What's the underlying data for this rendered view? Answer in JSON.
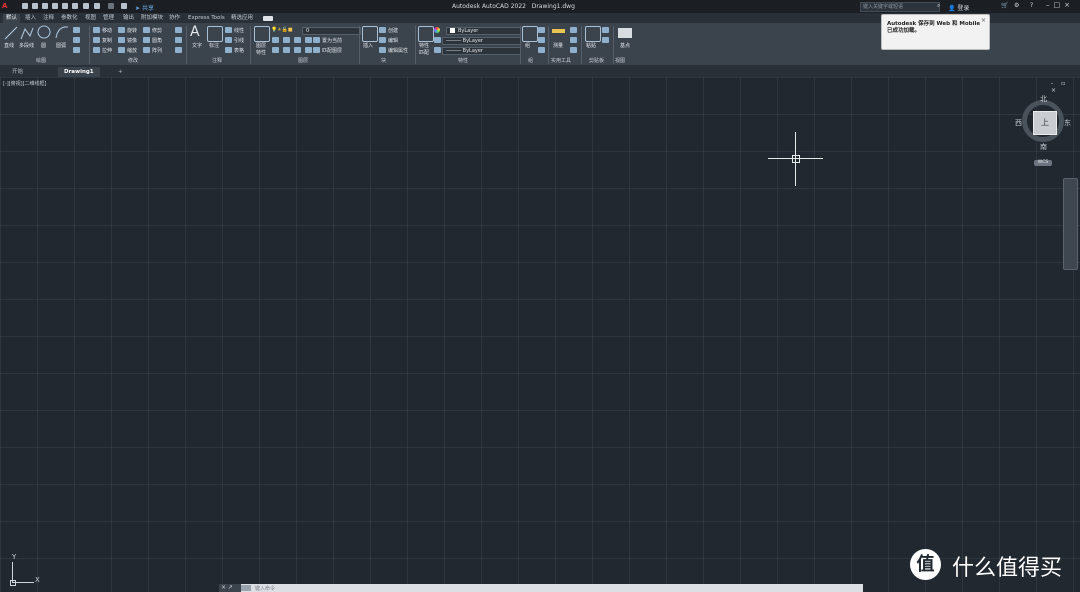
{
  "app": {
    "logo": "A",
    "title": "Autodesk AutoCAD 2022",
    "document": "Drawing1.dwg",
    "share_label": "共享",
    "search_placeholder": "键入关键字或短语",
    "login_label": "登录"
  },
  "ribbon_tabs": [
    "默认",
    "插入",
    "注释",
    "参数化",
    "视图",
    "管理",
    "输出",
    "附加模块",
    "协作",
    "Express Tools",
    "精选应用"
  ],
  "ribbon": {
    "draw": {
      "line": "直线",
      "polyline": "多段线",
      "circle": "圆",
      "arc": "圆弧",
      "panel": "绘图"
    },
    "modify": {
      "move": "移动",
      "rotate": "旋转",
      "trim": "修剪",
      "copy": "复制",
      "mirror": "镜像",
      "fillet": "圆角",
      "stretch": "拉伸",
      "scale": "缩放",
      "array": "阵列",
      "panel": "修改"
    },
    "annotation": {
      "text": "文字",
      "dimension": "标注",
      "linear": "线性",
      "leader": "引线",
      "table": "表格",
      "panel": "注释"
    },
    "layers": {
      "layer_props": "图层",
      "layer_props2": "特性",
      "current_layer": "0",
      "set_current": "置为当前",
      "match_layer": "匹配图层",
      "panel": "图层"
    },
    "block": {
      "insert": "插入",
      "create": "创建",
      "edit": "编辑",
      "edit_attr": "编辑属性",
      "panel": "块"
    },
    "properties": {
      "match": "特性",
      "match2": "匹配",
      "color": "ByLayer",
      "linetype": "ByLayer",
      "lineweight": "ByLayer",
      "panel": "特性"
    },
    "groups": {
      "group": "组",
      "panel": "组"
    },
    "utilities": {
      "measure": "测量",
      "panel": "实用工具"
    },
    "clipboard": {
      "paste": "粘贴",
      "panel": "剪贴板"
    },
    "view": {
      "base": "基点",
      "panel": "视图"
    }
  },
  "notification": {
    "message": "Autodesk 保存到 Web 和 Mobile 已成功加载。",
    "close": "×"
  },
  "file_tabs": [
    "开始",
    "Drawing1",
    "+"
  ],
  "viewport": {
    "label": "[-][俯视][二维线框]",
    "controls": "- ▫ ×"
  },
  "viewcube": {
    "north": "北",
    "south": "南",
    "east": "东",
    "west": "西",
    "face": "上",
    "wcs": "WCS"
  },
  "ucs": {
    "x": "X",
    "y": "Y"
  },
  "command_line": {
    "buttons": "× ↗",
    "prompt": "键入命令"
  },
  "watermark": {
    "icon": "值",
    "text": "什么值得买"
  }
}
